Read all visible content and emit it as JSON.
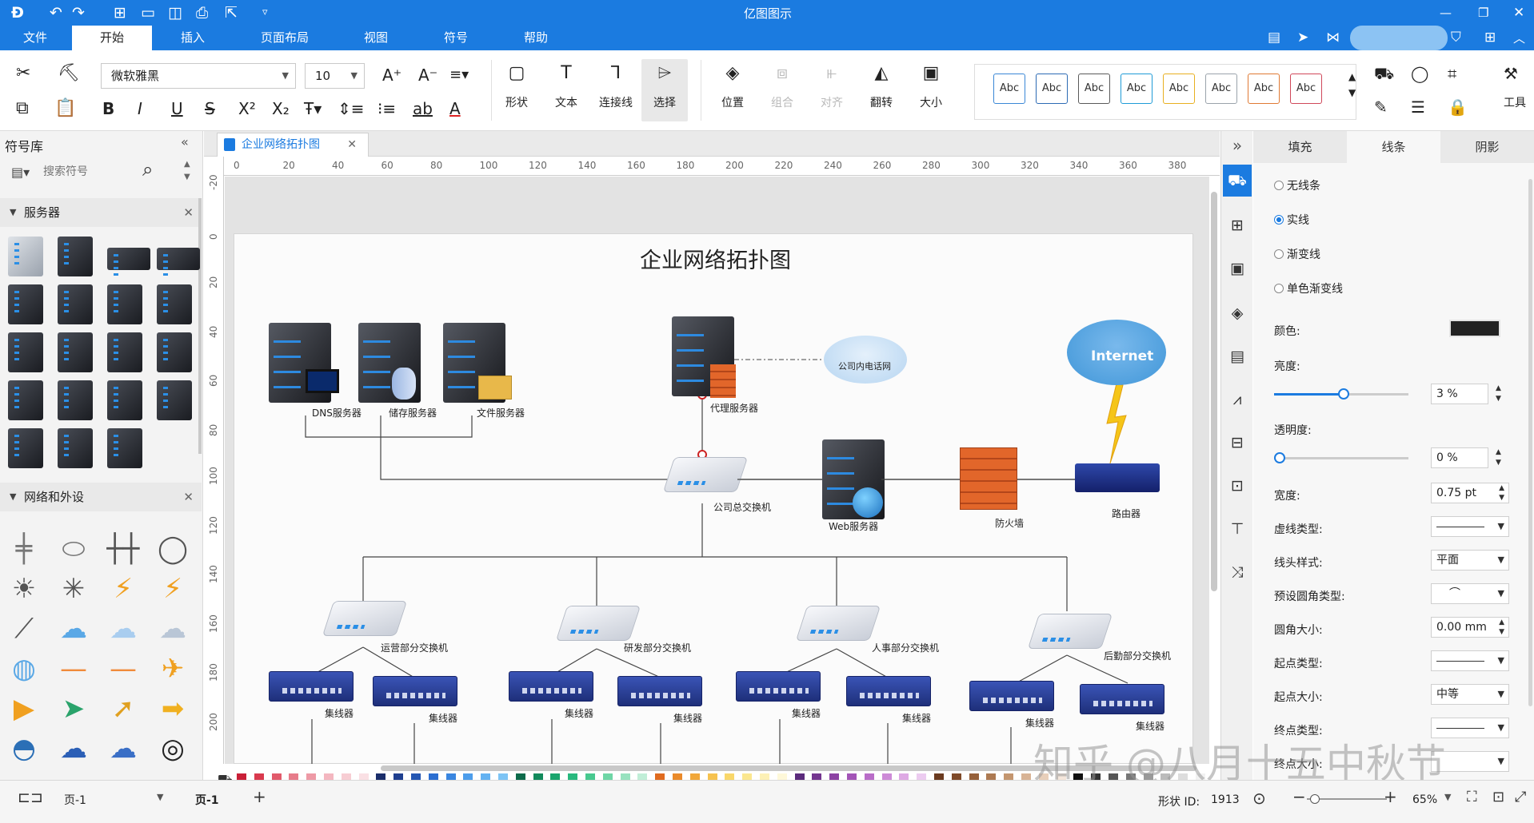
{
  "app": {
    "title": "亿图图示"
  },
  "menu": {
    "tabs": [
      "文件",
      "开始",
      "插入",
      "页面布局",
      "视图",
      "符号",
      "帮助"
    ],
    "active": "开始"
  },
  "ribbon": {
    "font_name": "微软雅黑",
    "font_size": "10",
    "groups": {
      "shape": "形状",
      "text": "文本",
      "connector": "连接线",
      "select": "选择",
      "position": "位置",
      "group": "组合",
      "align": "对齐",
      "flip": "翻转",
      "size": "大小",
      "tools": "工具"
    },
    "styles": [
      "Abc",
      "Abc",
      "Abc",
      "Abc",
      "Abc",
      "Abc",
      "Abc",
      "Abc"
    ],
    "style_colors": [
      "#3a87d6",
      "#2d6bb4",
      "#5a5a5a",
      "#1f9bd7",
      "#e8b021",
      "#9aa3ab",
      "#e07a34",
      "#d0485a"
    ]
  },
  "library": {
    "title": "符号库",
    "search_placeholder": "搜索符号",
    "sections": [
      "服务器",
      "网络和外设"
    ]
  },
  "doc": {
    "tab": "企业网络拓扑图"
  },
  "rulers": {
    "h": [
      "0",
      "20",
      "40",
      "60",
      "80",
      "100",
      "120",
      "140",
      "160",
      "180",
      "200",
      "220",
      "240",
      "260",
      "280",
      "300",
      "320",
      "340",
      "360",
      "380"
    ],
    "v": [
      "-20",
      "0",
      "20",
      "40",
      "60",
      "80",
      "100",
      "120",
      "140",
      "160",
      "180",
      "200"
    ]
  },
  "diagram": {
    "title": "企业网络拓扑图",
    "dns": "DNS服务器",
    "storage": "储存服务器",
    "file": "文件服务器",
    "proxy": "代理服务器",
    "intranet": "公司内电话网",
    "internet": "Internet",
    "core_switch": "公司总交换机",
    "web": "Web服务器",
    "firewall": "防火墙",
    "router": "路由器",
    "ops_switch": "运营部分交换机",
    "rd_switch": "研发部分交换机",
    "hr_switch": "人事部分交换机",
    "logistics_switch": "后勤部分交换机",
    "hub": "集线器"
  },
  "panel": {
    "tabs": [
      "填充",
      "线条",
      "阴影"
    ],
    "active": "线条",
    "line_options": [
      "无线条",
      "实线",
      "渐变线",
      "单色渐变线"
    ],
    "color_label": "颜色:",
    "color": "#222222",
    "brightness_label": "亮度:",
    "brightness": "3 %",
    "transparency_label": "透明度:",
    "transparency": "0 %",
    "width_label": "宽度:",
    "width": "0.75 pt",
    "dash_label": "虚线类型:",
    "cap_label": "线头样式:",
    "cap": "平面",
    "corner_type_label": "预设圆角类型:",
    "corner_size_label": "圆角大小:",
    "corner_size": "0.00 mm",
    "start_type_label": "起点类型:",
    "start_size_label": "起点大小:",
    "start_size": "中等",
    "end_type_label": "终点类型:",
    "end_size_label": "终点大小:"
  },
  "status": {
    "page_left": "页-1",
    "page_tab": "页-1",
    "add": "+",
    "shape_id_label": "形状 ID:",
    "shape_id": "1913",
    "zoom": "65%"
  },
  "watermark": "知乎 @八月十五中秋节",
  "swatches": [
    "#c91f37",
    "#d93a4e",
    "#e25a6b",
    "#e77c8a",
    "#ee9aa6",
    "#f4b7c0",
    "#f7cdd3",
    "#fae0e4",
    "#1b2e6b",
    "#1f3f8f",
    "#2456b2",
    "#2b6ed1",
    "#3a86e0",
    "#4d9deb",
    "#63b2f2",
    "#7dc4f5",
    "#0d6b4b",
    "#128a5c",
    "#1aa56d",
    "#29b97e",
    "#48c98f",
    "#6fd6a6",
    "#98e2bf",
    "#c0eed7",
    "#e06b1f",
    "#ea8a2a",
    "#f1a73a",
    "#f6c24f",
    "#f9d76a",
    "#fbe78f",
    "#fdf1b6",
    "#fef8d9",
    "#5b2b7c",
    "#74358f",
    "#8c42a3",
    "#a354b7",
    "#b96dc8",
    "#cd8ad7",
    "#dea9e4",
    "#eccbf0",
    "#6b3b1f",
    "#7f4a29",
    "#96603a",
    "#ad7a52",
    "#c4966f",
    "#d8b395",
    "#e8cfba",
    "#f4e6db",
    "#111111",
    "#333333",
    "#555555",
    "#777777",
    "#999999",
    "#bbbbbb",
    "#dddddd",
    "#f2f2f2"
  ]
}
